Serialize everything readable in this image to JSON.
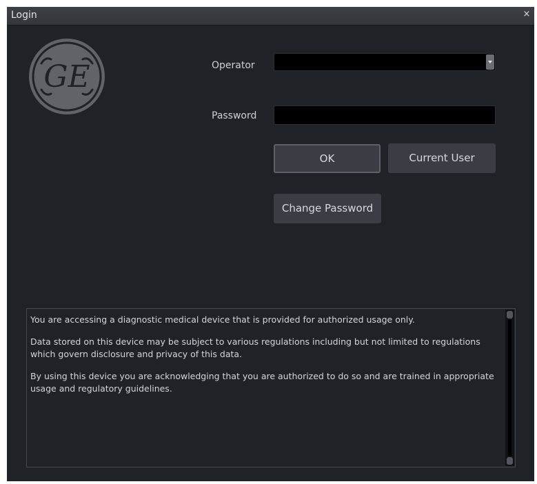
{
  "window": {
    "title": "Login",
    "close_glyph": "×"
  },
  "logo": {
    "icon": "ge-logo-icon",
    "text": "GE"
  },
  "form": {
    "operator_label": "Operator",
    "operator_value": "",
    "password_label": "Password",
    "password_value": ""
  },
  "buttons": {
    "ok": "OK",
    "current_user": "Current User",
    "change_password": "Change Password"
  },
  "notice": {
    "paragraphs": [
      "You are accessing a diagnostic medical device that is provided for authorized usage only.",
      "Data stored on this device may be subject to various regulations including but not limited to regulations which govern disclosure and privacy of this data.",
      "By using this device you are acknowledging that you are authorized to do so and are trained in appropriate usage and regulatory guidelines."
    ]
  },
  "colors": {
    "background": "#1f2227",
    "titlebar": "#3d4046",
    "button": "#3a3e44",
    "field": "#000000"
  }
}
